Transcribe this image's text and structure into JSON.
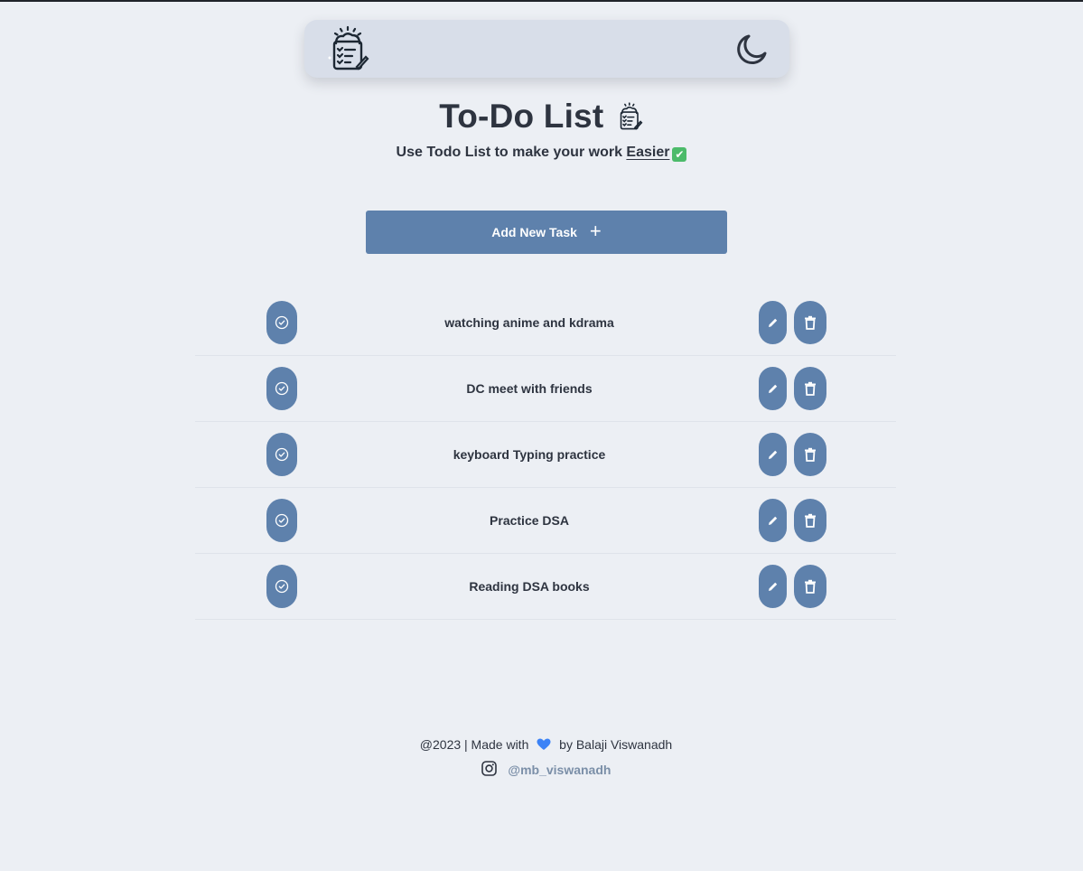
{
  "header": {
    "logo_icon": "clipboard-list-icon",
    "theme_toggle_icon": "moon-icon"
  },
  "hero": {
    "title": "To-Do List",
    "title_icon": "clipboard-list-icon",
    "subtitle_prefix": "Use Todo List to make your work ",
    "subtitle_link": "Easier",
    "subtitle_emoji": "✔"
  },
  "actions": {
    "add_task_label": "Add New Task",
    "add_task_icon": "+"
  },
  "tasks": [
    {
      "text": "watching anime and kdrama"
    },
    {
      "text": "DC meet with friends"
    },
    {
      "text": "keyboard Typing practice"
    },
    {
      "text": "Practice DSA"
    },
    {
      "text": "Reading DSA books"
    }
  ],
  "footer": {
    "line1_prefix": "@2023 | Made with",
    "line1_suffix": "by Balaji Viswanadh",
    "instagram_handle": "@mb_viswanadh"
  },
  "colors": {
    "background": "#eceff4",
    "navbar": "#d8dee9",
    "accent": "#5e81ac",
    "text": "#2e3440",
    "link_muted": "#7b8fa8"
  }
}
